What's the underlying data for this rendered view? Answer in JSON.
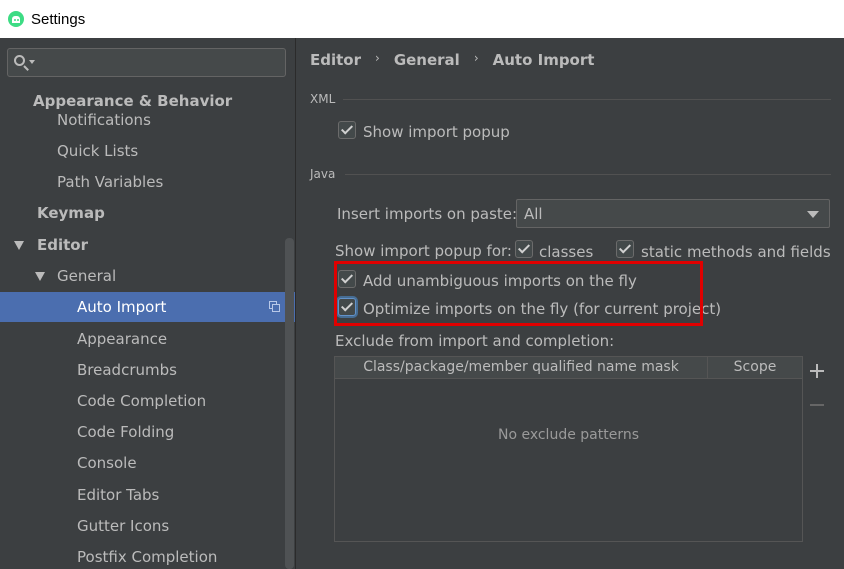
{
  "window": {
    "title": "Settings"
  },
  "search": {
    "value": "",
    "placeholder": ""
  },
  "sidebar": {
    "items": [
      {
        "label": "Appearance & Behavior"
      },
      {
        "label": "Notifications"
      },
      {
        "label": "Quick Lists"
      },
      {
        "label": "Path Variables"
      },
      {
        "label": "Keymap"
      },
      {
        "label": "Editor"
      },
      {
        "label": "General"
      },
      {
        "label": "Auto Import"
      },
      {
        "label": "Appearance"
      },
      {
        "label": "Breadcrumbs"
      },
      {
        "label": "Code Completion"
      },
      {
        "label": "Code Folding"
      },
      {
        "label": "Console"
      },
      {
        "label": "Editor Tabs"
      },
      {
        "label": "Gutter Icons"
      },
      {
        "label": "Postfix Completion"
      }
    ],
    "selected": "Auto Import"
  },
  "breadcrumb": {
    "items": [
      "Editor",
      "General",
      "Auto Import"
    ],
    "separator": "›"
  },
  "xml": {
    "title": "XML",
    "show_import_popup": {
      "label": "Show import popup",
      "checked": true
    }
  },
  "java": {
    "title": "Java",
    "insert_imports": {
      "label": "Insert imports on paste:",
      "value": "All"
    },
    "show_import_popup_for": {
      "label": "Show import popup for:",
      "classes": {
        "label": "classes",
        "checked": true
      },
      "static": {
        "label": "static methods and fields",
        "checked": true
      }
    },
    "add_unambiguous": {
      "label": "Add unambiguous imports on the fly",
      "checked": true
    },
    "optimize_imports": {
      "label": "Optimize imports on the fly (for current project)",
      "checked": true
    },
    "exclude": {
      "label": "Exclude from import and completion:",
      "columns": [
        "Class/package/member qualified name mask",
        "Scope"
      ],
      "empty_text": "No exclude patterns"
    }
  },
  "colors": {
    "background": "#3c3f41",
    "selection": "#4b6eaf",
    "highlight": "#e00000"
  }
}
